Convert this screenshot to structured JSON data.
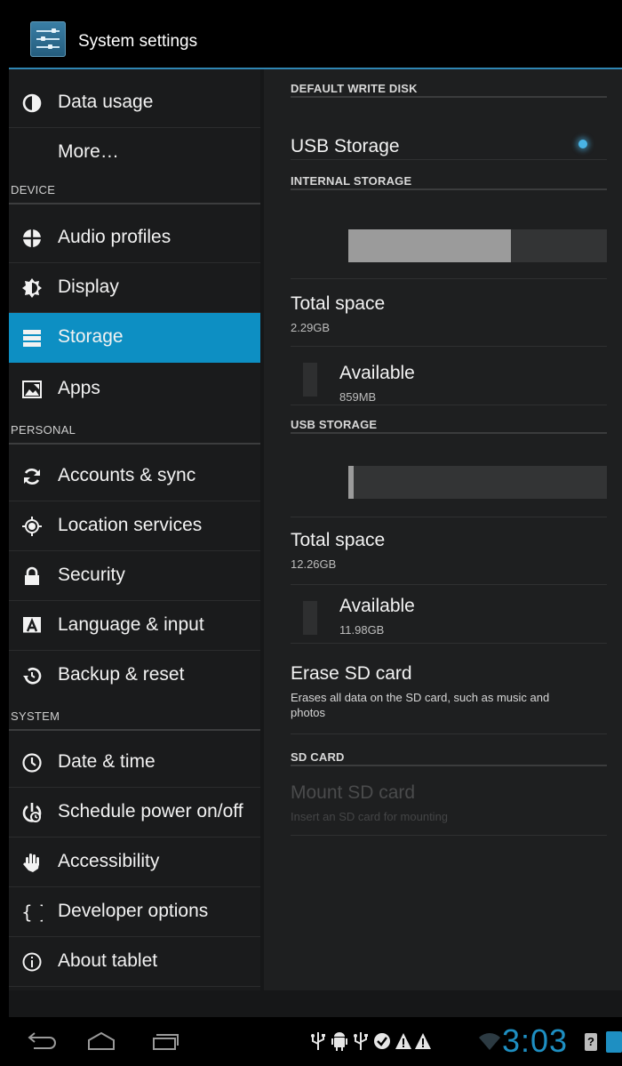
{
  "action_bar": {
    "title": "System settings"
  },
  "sidebar": {
    "items": [
      {
        "label": "Data usage",
        "icon": "data-usage-icon"
      },
      {
        "label": "More…",
        "icon": ""
      },
      {
        "category": "DEVICE"
      },
      {
        "label": "Audio profiles",
        "icon": "audio-profiles-icon"
      },
      {
        "label": "Display",
        "icon": "display-icon"
      },
      {
        "label": "Storage",
        "icon": "storage-icon",
        "selected": true
      },
      {
        "label": "Apps",
        "icon": "apps-icon"
      },
      {
        "category": "PERSONAL"
      },
      {
        "label": "Accounts & sync",
        "icon": "sync-icon"
      },
      {
        "label": "Location services",
        "icon": "location-icon"
      },
      {
        "label": "Security",
        "icon": "lock-icon"
      },
      {
        "label": "Language & input",
        "icon": "language-icon"
      },
      {
        "label": "Backup & reset",
        "icon": "backup-icon"
      },
      {
        "category": "SYSTEM"
      },
      {
        "label": "Date & time",
        "icon": "clock-icon"
      },
      {
        "label": "Schedule power on/off",
        "icon": "schedule-power-icon"
      },
      {
        "label": "Accessibility",
        "icon": "hand-icon"
      },
      {
        "label": "Developer options",
        "icon": "braces-icon"
      },
      {
        "label": "About tablet",
        "icon": "info-icon"
      }
    ]
  },
  "storage": {
    "default_write_disk": {
      "header": "DEFAULT WRITE DISK",
      "option": "USB Storage",
      "selected": true
    },
    "internal": {
      "header": "INTERNAL STORAGE",
      "used_fraction": 0.63,
      "total_label": "Total space",
      "total_value": "2.29GB",
      "available_label": "Available",
      "available_value": "859MB"
    },
    "usb": {
      "header": "USB STORAGE",
      "used_fraction": 0.02,
      "total_label": "Total space",
      "total_value": "12.26GB",
      "available_label": "Available",
      "available_value": "11.98GB",
      "erase_title": "Erase SD card",
      "erase_summary": "Erases all data on the SD card, such as music and photos"
    },
    "sd": {
      "header": "SD CARD",
      "mount_title": "Mount SD card",
      "mount_summary": "Insert an SD card for mounting",
      "enabled": false
    }
  },
  "status_bar": {
    "time": "3:03",
    "accent_color": "#1e8fc2"
  },
  "colors": {
    "selected": "#0d8fc3",
    "accent_line": "#2f86b3"
  }
}
